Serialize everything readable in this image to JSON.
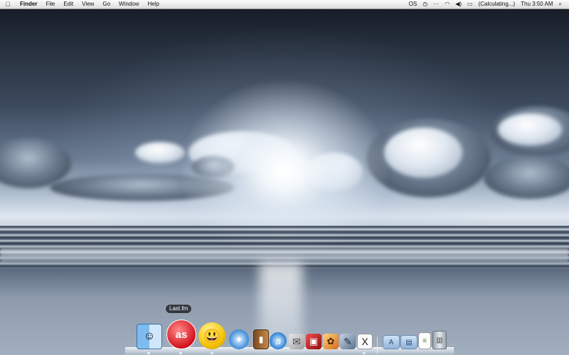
{
  "menubar": {
    "apple_icon": "apple-logo",
    "app_name": "Finder",
    "menus": [
      "File",
      "Edit",
      "View",
      "Go",
      "Window",
      "Help"
    ],
    "status": {
      "lastfm_glyph": "OS",
      "battery_text": "(Calculating...)",
      "clock": "Thu 3:50 AM"
    }
  },
  "dock": {
    "tooltip": "Last.fm",
    "items": [
      {
        "name": "finder",
        "glyph": "☺"
      },
      {
        "name": "last.fm",
        "glyph": "as"
      },
      {
        "name": "messenger",
        "glyph": "😃"
      },
      {
        "name": "safari",
        "glyph": "✦"
      },
      {
        "name": "book",
        "glyph": "▮"
      },
      {
        "name": "itunes",
        "glyph": "♫"
      },
      {
        "name": "mail",
        "glyph": "✉"
      },
      {
        "name": "photo-booth",
        "glyph": "▣"
      },
      {
        "name": "iphoto",
        "glyph": "✿"
      },
      {
        "name": "xcode",
        "glyph": "✎"
      },
      {
        "name": "x11",
        "glyph": "X"
      },
      {
        "name": "applications-folder",
        "glyph": "A"
      },
      {
        "name": "documents-folder",
        "glyph": "▤"
      },
      {
        "name": "text-document",
        "glyph": "≡"
      },
      {
        "name": "trash",
        "glyph": "▥"
      }
    ]
  },
  "colors": {
    "menubar_bg": "#e6e6e6",
    "tooltip_bg": "#1e2228",
    "lastfm_red": "#d3121c"
  }
}
